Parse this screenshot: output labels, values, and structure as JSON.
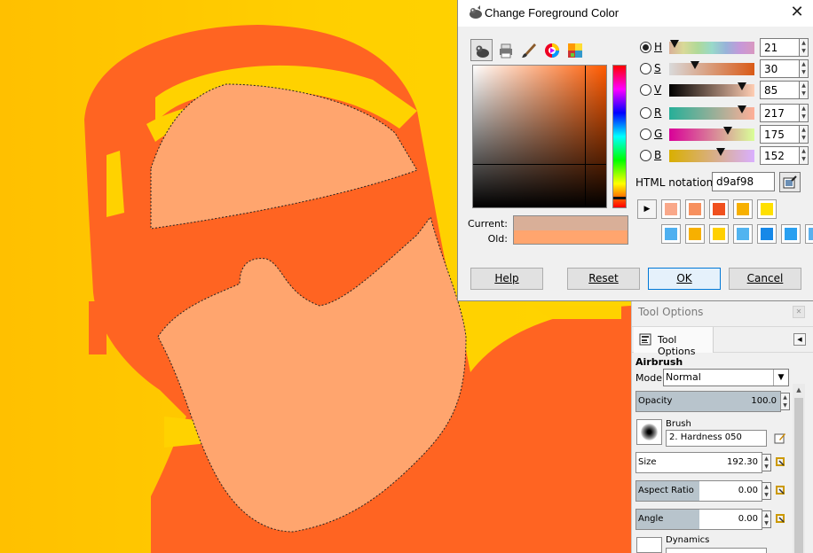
{
  "dialog": {
    "title": "Change Foreground Color",
    "selector_tabs": [
      "gimp-selector-icon",
      "printer-cmyk-icon",
      "watercolor-brush-icon",
      "color-wheel-icon",
      "palette-icon"
    ],
    "current_label": "Current:",
    "old_label": "Old:",
    "current_color": "#d9af98",
    "old_color": "#ffa56e",
    "channels": [
      {
        "key": "H",
        "value": "21",
        "selected": true,
        "position": 0.06,
        "gradient": "linear-gradient(to right,#d9af98,#d9d998,#b0d998,#98d9c9,#98b3d9,#c698d9,#d998c0)"
      },
      {
        "key": "S",
        "value": "30",
        "selected": false,
        "position": 0.3,
        "gradient": "linear-gradient(to right,#d9d9d9,#d95a16)"
      },
      {
        "key": "V",
        "value": "85",
        "selected": false,
        "position": 0.85,
        "gradient": "linear-gradient(to right,#000,#ffcdb3)"
      },
      {
        "key": "R",
        "value": "217",
        "selected": false,
        "position": 0.85,
        "gradient": "linear-gradient(to right,#26af98,#ffaf98)"
      },
      {
        "key": "G",
        "value": "175",
        "selected": false,
        "position": 0.69,
        "gradient": "linear-gradient(to right,#d90098,#d9ff98)"
      },
      {
        "key": "B",
        "value": "152",
        "selected": false,
        "position": 0.6,
        "gradient": "linear-gradient(to right,#d9af00,#d9afff)"
      }
    ],
    "html_label": "HTML notation:",
    "html_value": "d9af98",
    "history_colors": [
      "#f9a88a",
      "#f7905e",
      "#f0501e",
      "#f7b000",
      "#ffe000",
      "#4fb0f0",
      "#f7b000",
      "#ffd000",
      "#52b4f0",
      "#1688e8",
      "#2aa0f0",
      "#5ab0ee"
    ],
    "buttons": {
      "help": "Help",
      "reset": "Reset",
      "ok": "OK",
      "cancel": "Cancel"
    }
  },
  "tool_options": {
    "panel_title": "Tool Options",
    "tab_label": "Tool Options",
    "tool_name": "Airbrush",
    "mode_label": "Mode:",
    "mode_value": "Normal",
    "opacity": {
      "label": "Opacity",
      "value": "100.0",
      "fraction": 1.0
    },
    "brush_label": "Brush",
    "brush_value": "2. Hardness 050",
    "size": {
      "label": "Size",
      "value": "192.30",
      "fraction": 0.0
    },
    "aspect": {
      "label": "Aspect Ratio",
      "value": "0.00",
      "fraction": 0.5
    },
    "angle": {
      "label": "Angle",
      "value": "0.00",
      "fraction": 0.5
    },
    "dynamics_label": "Dynamics"
  },
  "colors": {
    "yellow": "#ffd200",
    "orange": "#ff6422",
    "skin": "#ffa56e"
  }
}
